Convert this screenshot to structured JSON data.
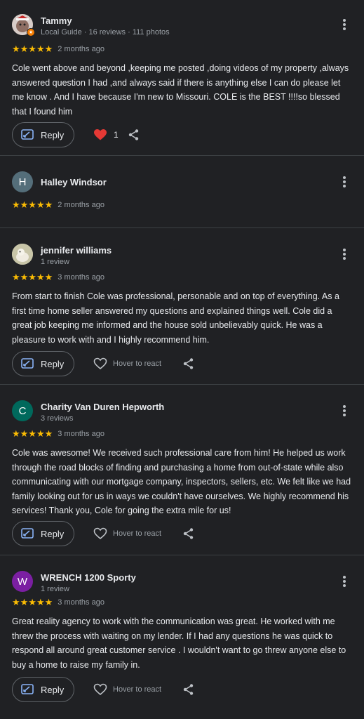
{
  "reviews": [
    {
      "name": "Tammy",
      "meta": "Local Guide · 16 reviews · 111 photos",
      "avatar": {
        "type": "photo",
        "initial": "",
        "color": "#7a6a58"
      },
      "stars": "★★★★★",
      "date": "2 months ago",
      "text": "Cole went above and beyond ,keeping me posted ,doing videos of my property ,always answered question I had ,and always said if there is anything else I can do please let me know . And I have because I'm new to Missouri. COLE is the BEST !!!!so blessed that I found him",
      "reply_label": "Reply",
      "reaction": {
        "liked": true,
        "count": "1",
        "label": ""
      }
    },
    {
      "name": "Halley Windsor",
      "meta": "",
      "avatar": {
        "type": "initial",
        "initial": "H",
        "color": "#546e7a"
      },
      "stars": "★★★★★",
      "date": "2 months ago",
      "text": "",
      "reply_label": "",
      "reaction": null
    },
    {
      "name": "jennifer williams",
      "meta": "1 review",
      "avatar": {
        "type": "photo",
        "initial": "",
        "color": "#b7b49a"
      },
      "stars": "★★★★★",
      "date": "3 months ago",
      "text": "From start to finish Cole was professional, personable and on top of everything. As a first time home seller answered my questions and explained things well. Cole did a great job keeping me informed and the house sold unbelievably quick. He was a pleasure to work with and I highly recommend him.",
      "reply_label": "Reply",
      "reaction": {
        "liked": false,
        "count": "",
        "label": "Hover to react"
      }
    },
    {
      "name": "Charity Van Duren Hepworth",
      "meta": "3 reviews",
      "avatar": {
        "type": "initial",
        "initial": "C",
        "color": "#00695c"
      },
      "stars": "★★★★★",
      "date": "3 months ago",
      "text": "Cole was awesome! We received such professional care from him! He helped us work through the road blocks of finding and purchasing a home from out-of-state while also communicating with our mortgage company, inspectors, sellers, etc. We felt like we had family looking out for us in ways we couldn't have ourselves. We highly recommend his services! Thank you, Cole for going the extra mile for us!",
      "reply_label": "Reply",
      "reaction": {
        "liked": false,
        "count": "",
        "label": "Hover to react"
      }
    },
    {
      "name": "WRENCH 1200 Sporty",
      "meta": "1 review",
      "avatar": {
        "type": "initial",
        "initial": "W",
        "color": "#7b1fa2"
      },
      "stars": "★★★★★",
      "date": "3 months ago",
      "text": "Great reality agency to work with the communication was great. He worked with me threw the process with waiting on my lender. If I had any questions he was quick to respond all around great customer service . I wouldn't want to go threw anyone else to buy a home to raise my family in.",
      "reply_label": "Reply",
      "reaction": {
        "liked": false,
        "count": "",
        "label": "Hover to react"
      }
    }
  ]
}
